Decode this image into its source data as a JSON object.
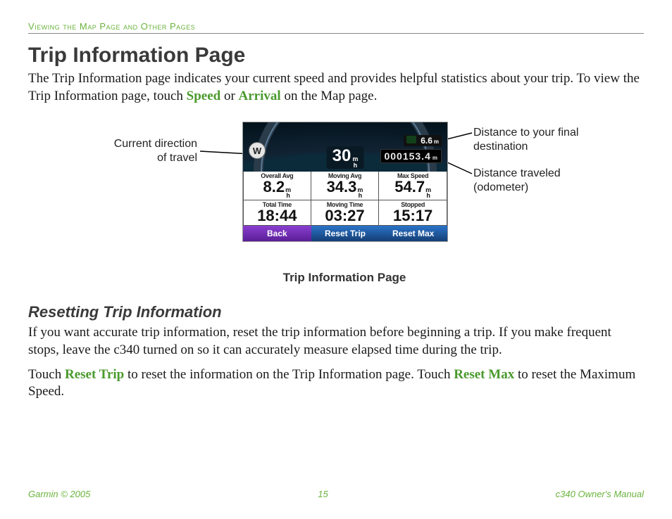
{
  "header": {
    "running_title": "Viewing the Map Page and Other Pages"
  },
  "title": "Trip Information Page",
  "intro": {
    "before_speed": "The Trip Information page indicates your current speed and provides helpful statistics about your trip. To view the Trip Information page, touch ",
    "speed": "Speed",
    "mid": " or ",
    "arrival": "Arrival",
    "after": " on the Map page."
  },
  "callouts": {
    "left1a": "Current direction",
    "left1b": "of travel",
    "right1a": "Distance to your final",
    "right1b": "destination",
    "right2a": "Distance traveled",
    "right2b": "(odometer)"
  },
  "device": {
    "direction": "W",
    "speed": "30",
    "speed_unit_top": "m",
    "speed_unit_bot": "h",
    "dist_final": "6.6",
    "dist_final_unit": "m",
    "odometer": "000153.4",
    "odometer_unit": "m",
    "row1": {
      "c1_label": "Overall Avg",
      "c1_value": "8.2",
      "c2_label": "Moving Avg",
      "c2_value": "34.3",
      "c3_label": "Max Speed",
      "c3_value": "54.7"
    },
    "row2": {
      "c1_label": "Total Time",
      "c1_value": "18:44",
      "c2_label": "Moving Time",
      "c2_value": "03:27",
      "c3_label": "Stopped",
      "c3_value": "15:17"
    },
    "buttons": {
      "back": "Back",
      "reset_trip": "Reset Trip",
      "reset_max": "Reset Max"
    }
  },
  "figure_caption": "Trip Information Page",
  "section2": {
    "heading": "Resetting Trip Information",
    "p1": "If you want accurate trip information, reset the trip information before beginning a trip. If you make frequent stops, leave the c340 turned on so it can accurately measure elapsed time during the trip.",
    "p2_before": "Touch ",
    "reset_trip": "Reset Trip",
    "p2_mid": " to reset the information on the Trip Information page. Touch ",
    "reset_max": "Reset Max",
    "p2_after": " to reset the Maximum Speed."
  },
  "footer": {
    "left": "Garmin © 2005",
    "center": "15",
    "right": "c340 Owner's Manual"
  }
}
